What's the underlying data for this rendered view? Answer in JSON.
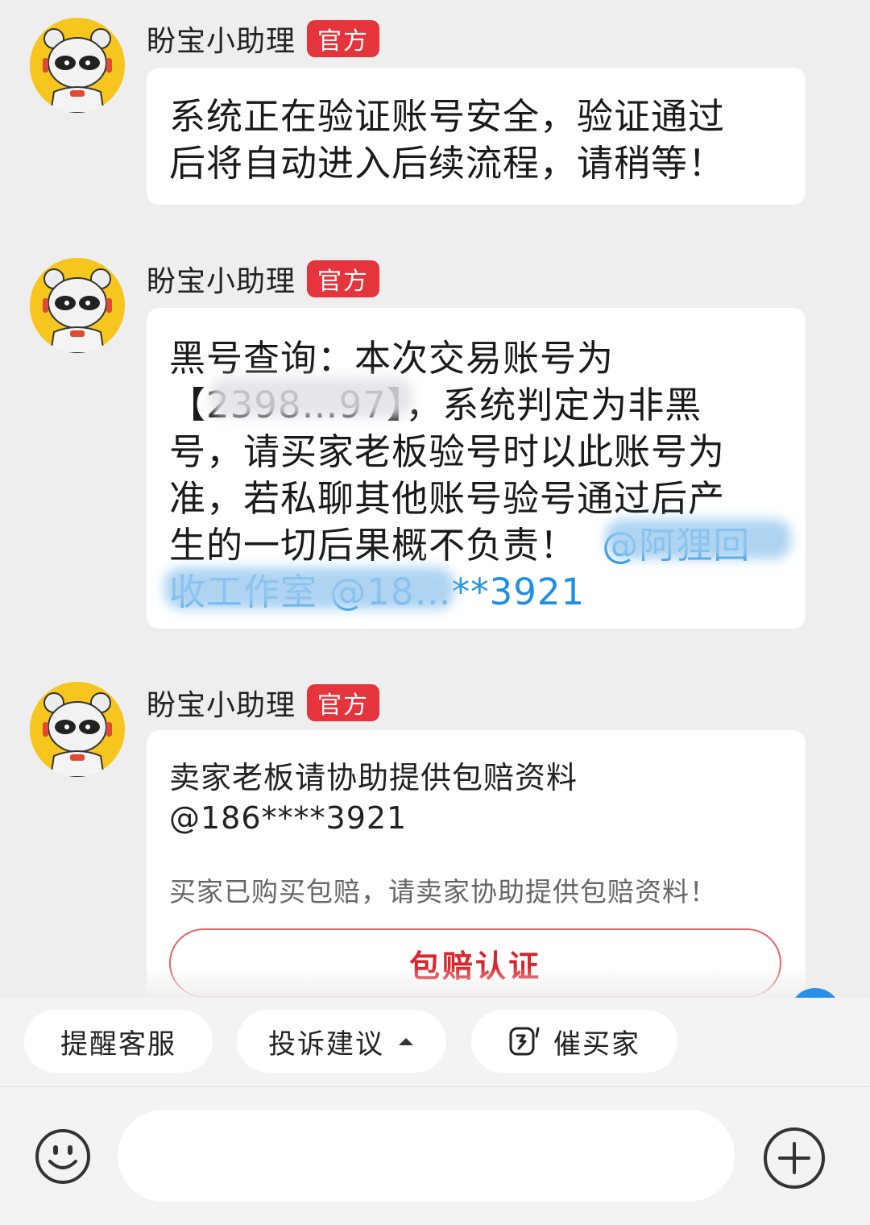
{
  "messages": [
    {
      "sender": "盼宝小助理",
      "badge": "官方",
      "lines": [
        "系统正在验证账号安全，验证通过",
        "后将自动进入后续流程，请稍等！"
      ]
    },
    {
      "sender": "盼宝小助理",
      "badge": "官方",
      "lines": [
        "黑号查询：本次交易账号为",
        "【2398…97】，系统判定为非黑",
        "号，请买家老板验号时以此账号为",
        "准，若私聊其他账号验号通过后产",
        "生的一切后果概不负责！"
      ],
      "mention1": "@阿狸回",
      "mention2": "收工作室 @18…**3921"
    },
    {
      "sender": "盼宝小助理",
      "badge": "官方",
      "card_title": "卖家老板请协助提供包赔资料",
      "card_mention": "@186****3921",
      "card_sub": "买家已购买包赔，请卖家协助提供包赔资料！",
      "card_button": "包赔认证"
    }
  ],
  "quick_actions": {
    "remind": "提醒客服",
    "complain": "投诉建议",
    "urge": "催买家"
  },
  "input": {
    "placeholder": ""
  },
  "icons": [
    "avatar-panda-icon",
    "caret-up-icon",
    "urge-icon",
    "emoji-icon",
    "plus-icon"
  ],
  "colors": {
    "badge": "#e5343b",
    "mention": "#1f8fe6",
    "button_text": "#d9262c"
  }
}
